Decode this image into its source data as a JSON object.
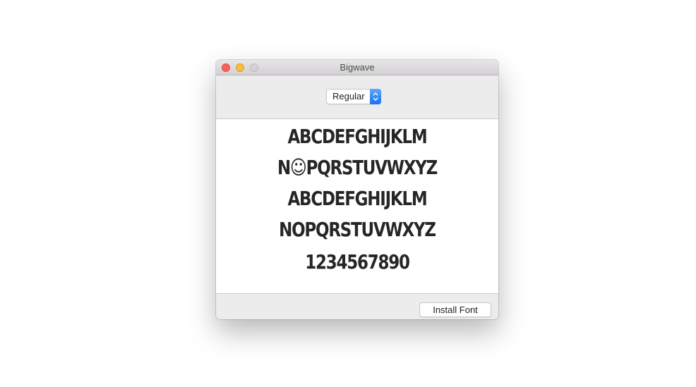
{
  "window": {
    "title": "Bigwave"
  },
  "toolbar": {
    "style_popup": {
      "selected": "Regular"
    }
  },
  "preview": {
    "lines": [
      "ABCDEFGHIJKLM",
      "N☺PQRSTUVWXYZ",
      "ABCDEFGHIJKLM",
      "NOPQRSTUVWXYZ",
      "1234567890"
    ]
  },
  "footer": {
    "install_label": "Install Font"
  },
  "icons": {
    "close": "close-traffic-light",
    "minimize": "minimize-traffic-light",
    "zoom": "zoom-traffic-light",
    "popup_arrows": "up-down-chevron-icon"
  }
}
